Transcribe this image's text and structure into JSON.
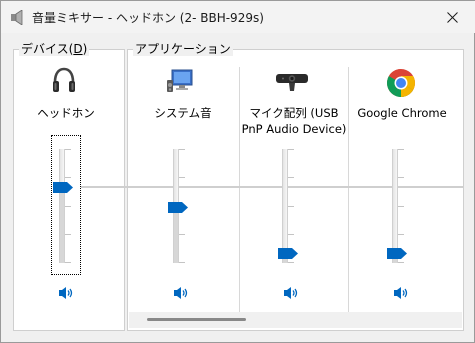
{
  "window": {
    "title": "音量ミキサー - ヘッドホン (2- BBH-929s)",
    "icon": "speaker-icon"
  },
  "groups": {
    "device_label": "デバイス(D)",
    "device_label_main": "デバイス(",
    "device_label_key": "D",
    "device_label_end": ")",
    "apps_label": "アプリケーション"
  },
  "device": {
    "name": "ヘッドホン",
    "icon": "headphones-icon",
    "volume_percent": 70,
    "muted": false
  },
  "apps": [
    {
      "name_line1": "システム音",
      "name_line2": "",
      "icon": "system-sounds-icon",
      "volume_percent": 52,
      "muted": false
    },
    {
      "name_line1": "マイク配列 (USB",
      "name_line2": "PnP Audio Device)",
      "icon": "webcam-mic-icon",
      "volume_percent": 9,
      "muted": false
    },
    {
      "name_line1": "Google Chrome",
      "name_line2": "",
      "icon": "chrome-icon",
      "volume_percent": 9,
      "muted": false
    }
  ],
  "colors": {
    "accent": "#0067c0",
    "window_bg": "#f0f0f0",
    "panel_bg": "#ffffff"
  }
}
